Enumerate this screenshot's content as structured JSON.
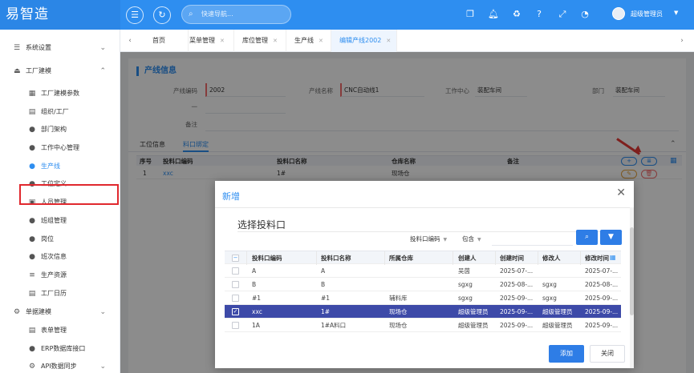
{
  "app": {
    "logo": "易智造"
  },
  "topbar": {
    "search_placeholder": "快速导航...",
    "user_name": "超级管理员"
  },
  "sidebar": {
    "groups": [
      {
        "label": "系统设置"
      },
      {
        "label": "工厂建模"
      },
      {
        "label": "单据建模"
      }
    ],
    "items": [
      {
        "label": "工厂建模参数"
      },
      {
        "label": "组织/工厂"
      },
      {
        "label": "部门架构"
      },
      {
        "label": "工作中心管理"
      },
      {
        "label": "生产线"
      },
      {
        "label": "工位定义"
      },
      {
        "label": "人员管理"
      },
      {
        "label": "班组管理"
      },
      {
        "label": "岗位"
      },
      {
        "label": "班次信息"
      },
      {
        "label": "生产资源"
      },
      {
        "label": "工厂日历"
      },
      {
        "label": "表单管理"
      },
      {
        "label": "ERP数据库接口"
      },
      {
        "label": "API数据同步"
      }
    ]
  },
  "tabs": [
    {
      "label": "首页"
    },
    {
      "label": "菜单管理"
    },
    {
      "label": "库位管理"
    },
    {
      "label": "生产线"
    },
    {
      "label": "编辑产线2002"
    }
  ],
  "form": {
    "section_title": "产线信息",
    "code_label": "产线编码",
    "code_value": "2002",
    "name_label": "产线名称",
    "name_value": "CNC自动线1",
    "center_label": "工作中心",
    "center_value": "装配车间",
    "dept_label": "部门",
    "dept_value": "装配车间",
    "dash_label": "一",
    "remark_label": "备注"
  },
  "subtabs": [
    {
      "label": "工位信息"
    },
    {
      "label": "料口绑定"
    }
  ],
  "grid": {
    "headers": [
      "序号",
      "投料口编码",
      "投料口名称",
      "仓库名称",
      "备注"
    ],
    "rows": [
      {
        "no": "1",
        "code": "xxc",
        "name": "1#",
        "warehouse": "现场仓",
        "remark": ""
      }
    ]
  },
  "modal": {
    "title": "新增",
    "subtitle": "选择投料口",
    "filter_field": "投料口编码",
    "filter_op": "包含",
    "headers": [
      "投料口编码",
      "投料口名称",
      "所属仓库",
      "创建人",
      "创建时间",
      "修改人",
      "修改时间"
    ],
    "rows": [
      {
        "code": "A",
        "name": "A",
        "warehouse": "",
        "creator": "吴茵",
        "created": "2025-07-...",
        "modifier": "",
        "modified": "2025-07-...",
        "checked": false
      },
      {
        "code": "B",
        "name": "B",
        "warehouse": "",
        "creator": "sgxg",
        "created": "2025-08-...",
        "modifier": "sgxg",
        "modified": "2025-08-...",
        "checked": false
      },
      {
        "code": "#1",
        "name": "#1",
        "warehouse": "辅料库",
        "creator": "sgxg",
        "created": "2025-09-...",
        "modifier": "sgxg",
        "modified": "2025-09-...",
        "checked": false
      },
      {
        "code": "xxc",
        "name": "1#",
        "warehouse": "现场仓",
        "creator": "超级管理员",
        "created": "2025-09-...",
        "modifier": "超级管理员",
        "modified": "2025-09-...",
        "checked": true
      },
      {
        "code": "1A",
        "name": "1#A料口",
        "warehouse": "现场仓",
        "creator": "超级管理员",
        "created": "2025-09-...",
        "modifier": "超级管理员",
        "modified": "2025-09-...",
        "checked": false
      }
    ],
    "add_label": "添加",
    "close_label": "关闭"
  },
  "colors": {
    "primary": "#2e8ef0",
    "selected_row": "#3d4aa8",
    "highlight": "#e0282e"
  }
}
